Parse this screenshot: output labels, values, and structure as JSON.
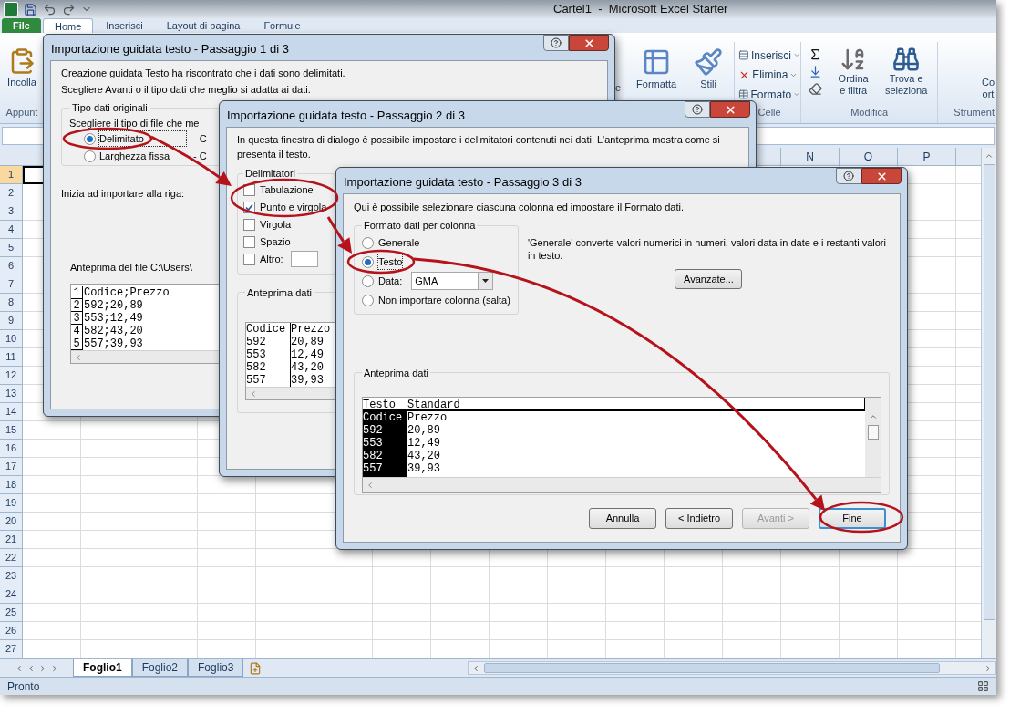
{
  "window": {
    "title": "Cartel1  -  Microsoft Excel Starter"
  },
  "ribbon_tabs": [
    {
      "label": "File",
      "selected": false,
      "kind": "file"
    },
    {
      "label": "Home",
      "selected": true,
      "kind": "tab"
    },
    {
      "label": "Inserisci",
      "selected": false,
      "kind": "tab"
    },
    {
      "label": "Layout di pagina",
      "selected": false,
      "kind": "tab"
    },
    {
      "label": "Formule",
      "selected": false,
      "kind": "tab"
    }
  ],
  "ribbon": {
    "paste": {
      "label": "Incolla",
      "group": "Appunt"
    },
    "fragment": "e",
    "format_button": "Formatta",
    "styles_button": "Stili",
    "cells": {
      "items": [
        "Inserisci",
        "Elimina",
        "Formato"
      ],
      "label": "Celle"
    },
    "editing": {
      "sort": [
        "Ordina",
        "e filtra"
      ],
      "find": [
        "Trova e",
        "seleziona"
      ],
      "label": "Modifica"
    },
    "tools": {
      "lines": [
        "Co",
        "ort"
      ],
      "label": "Strument"
    }
  },
  "columns": [
    {
      "label": "N",
      "selected": false
    },
    {
      "label": "O",
      "selected": false
    },
    {
      "label": "P",
      "selected": false
    }
  ],
  "rows": [
    {
      "label": "1",
      "selected": true
    },
    {
      "label": "2",
      "selected": false
    },
    {
      "label": "3",
      "selected": false
    },
    {
      "label": "4",
      "selected": false
    },
    {
      "label": "5",
      "selected": false
    },
    {
      "label": "6",
      "selected": false
    },
    {
      "label": "7",
      "selected": false
    },
    {
      "label": "8",
      "selected": false
    },
    {
      "label": "9",
      "selected": false
    },
    {
      "label": "10",
      "selected": false
    },
    {
      "label": "11",
      "selected": false
    },
    {
      "label": "12",
      "selected": false
    },
    {
      "label": "13",
      "selected": false
    },
    {
      "label": "14",
      "selected": false
    },
    {
      "label": "15",
      "selected": false
    },
    {
      "label": "16",
      "selected": false
    },
    {
      "label": "17",
      "selected": false
    },
    {
      "label": "18",
      "selected": false
    },
    {
      "label": "19",
      "selected": false
    },
    {
      "label": "20",
      "selected": false
    },
    {
      "label": "21",
      "selected": false
    },
    {
      "label": "22",
      "selected": false
    },
    {
      "label": "23",
      "selected": false
    },
    {
      "label": "24",
      "selected": false
    },
    {
      "label": "25",
      "selected": false
    },
    {
      "label": "26",
      "selected": false
    },
    {
      "label": "27",
      "selected": false
    }
  ],
  "sheet_tabs": [
    {
      "label": "Foglio1",
      "selected": true
    },
    {
      "label": "Foglio2",
      "selected": false
    },
    {
      "label": "Foglio3",
      "selected": false
    }
  ],
  "status_bar": {
    "text": "Pronto"
  },
  "dialogs": [
    {
      "kind": "step1",
      "title": "Importazione guidata testo - Passaggio 1 di 3",
      "intro": [
        "Creazione guidata Testo ha riscontrato che i dati sono delimitati.",
        "Scegliere Avanti o il tipo dati che meglio si adatta ai dati."
      ],
      "group": {
        "legend": "Tipo dati originali",
        "prompt": "Scegliere il tipo di file che me",
        "options": [
          {
            "label": "Delimitato",
            "selected": true,
            "note": "- C"
          },
          {
            "label": "Larghezza fissa",
            "selected": false,
            "note": "- C"
          }
        ]
      },
      "start_row_label": "Inizia ad importare alla riga:",
      "preview_label": "Anteprima del file C:\\Users\\",
      "preview_lines": [
        {
          "number": "1",
          "text": "Codice;Prezzo"
        },
        {
          "number": "2",
          "text": "592;20,89"
        },
        {
          "number": "3",
          "text": "553;12,49"
        },
        {
          "number": "4",
          "text": "582;43,20"
        },
        {
          "number": "5",
          "text": "557;39,93"
        }
      ]
    },
    {
      "kind": "step2",
      "title": "Importazione guidata testo - Passaggio 2 di 3",
      "intro": "In questa finestra di dialogo è possibile impostare i delimitatori contenuti nei dati. L'anteprima mostra come si presenta il testo.",
      "delimiters": {
        "legend": "Delimitatori",
        "items": [
          {
            "label": "Tabulazione",
            "checked": false,
            "kind": "plain"
          },
          {
            "label": "Punto e virgola",
            "checked": true,
            "kind": "plain"
          },
          {
            "label": "Virgola",
            "checked": false,
            "kind": "plain"
          },
          {
            "label": "Spazio",
            "checked": false,
            "kind": "plain"
          },
          {
            "label": "Altro:",
            "checked": false,
            "kind": "other"
          }
        ]
      },
      "preview": {
        "legend": "Anteprima dati",
        "columns": [
          {
            "cells": [
              "Codice",
              "592",
              "553",
              "582",
              "557"
            ]
          },
          {
            "cells": [
              "Prezzo",
              "20,89",
              "12,49",
              "43,20",
              "39,93"
            ]
          }
        ]
      }
    },
    {
      "kind": "step3",
      "title": "Importazione guidata testo - Passaggio 3 di 3",
      "intro": "Qui è possibile selezionare ciascuna colonna ed impostare il Formato dati.",
      "format": {
        "legend": "Formato dati per colonna",
        "options": [
          {
            "label": "Generale",
            "selected": false,
            "kind": "plain"
          },
          {
            "label": "Testo",
            "selected": true,
            "kind": "plain"
          },
          {
            "label": "Data:",
            "selected": false,
            "kind": "date",
            "value": "GMA"
          },
          {
            "label": "Non importare colonna (salta)",
            "selected": false,
            "kind": "plain"
          }
        ]
      },
      "note": "'Generale' converte valori numerici in numeri, valori data in date e i restanti valori in testo.",
      "advanced_button": "Avanzate...",
      "preview": {
        "legend": "Anteprima dati",
        "columns": [
          {
            "header": "Testo",
            "selected": true,
            "cells": [
              "Codice",
              "592",
              "553",
              "582",
              "557"
            ]
          },
          {
            "header": "Standard",
            "selected": false,
            "cells": [
              "Prezzo",
              "20,89",
              "12,49",
              "43,20",
              "39,93"
            ]
          }
        ]
      },
      "buttons": [
        {
          "label": "Annulla",
          "disabled": false,
          "default": false
        },
        {
          "label": "< Indietro",
          "disabled": false,
          "default": false
        },
        {
          "label": "Avanti >",
          "disabled": true,
          "default": false
        },
        {
          "label": "Fine",
          "disabled": false,
          "default": true
        }
      ]
    }
  ]
}
